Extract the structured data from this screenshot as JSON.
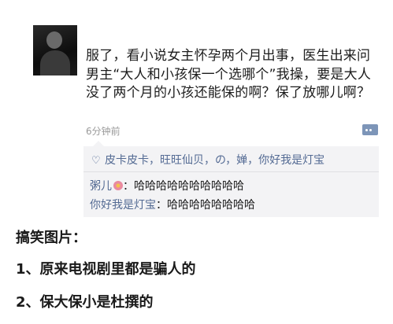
{
  "post": {
    "text": "服了，看小说女主怀孕两个月出事，医生出来问男主“大人和小孩保一个选哪个”我操，要是大人没了两个月的小孩还能保的啊？保了放哪儿啊？",
    "timestamp": "6分钟前"
  },
  "likes": {
    "text": "皮卡皮卡，旺旺仙贝，の，婵，你好我是灯宝"
  },
  "comments": [
    {
      "author": "粥儿",
      "separator": "：",
      "text": "哈哈哈哈哈哈哈哈哈哈"
    },
    {
      "author": "你好我是灯宝",
      "separator": "：",
      "text": "哈哈哈哈哈哈哈哈"
    }
  ],
  "caption": {
    "title": "搞笑图片：",
    "line1": "1、原来电视剧里都是骗人的",
    "line2": "2、保大保小是杜撰的"
  },
  "icons": [
    "avatar",
    "comment-icon",
    "heart-icon",
    "flower-icon"
  ],
  "colors": {
    "link": "#536a93",
    "panel": "#f3f3f5",
    "icon": "#7d95b8"
  }
}
